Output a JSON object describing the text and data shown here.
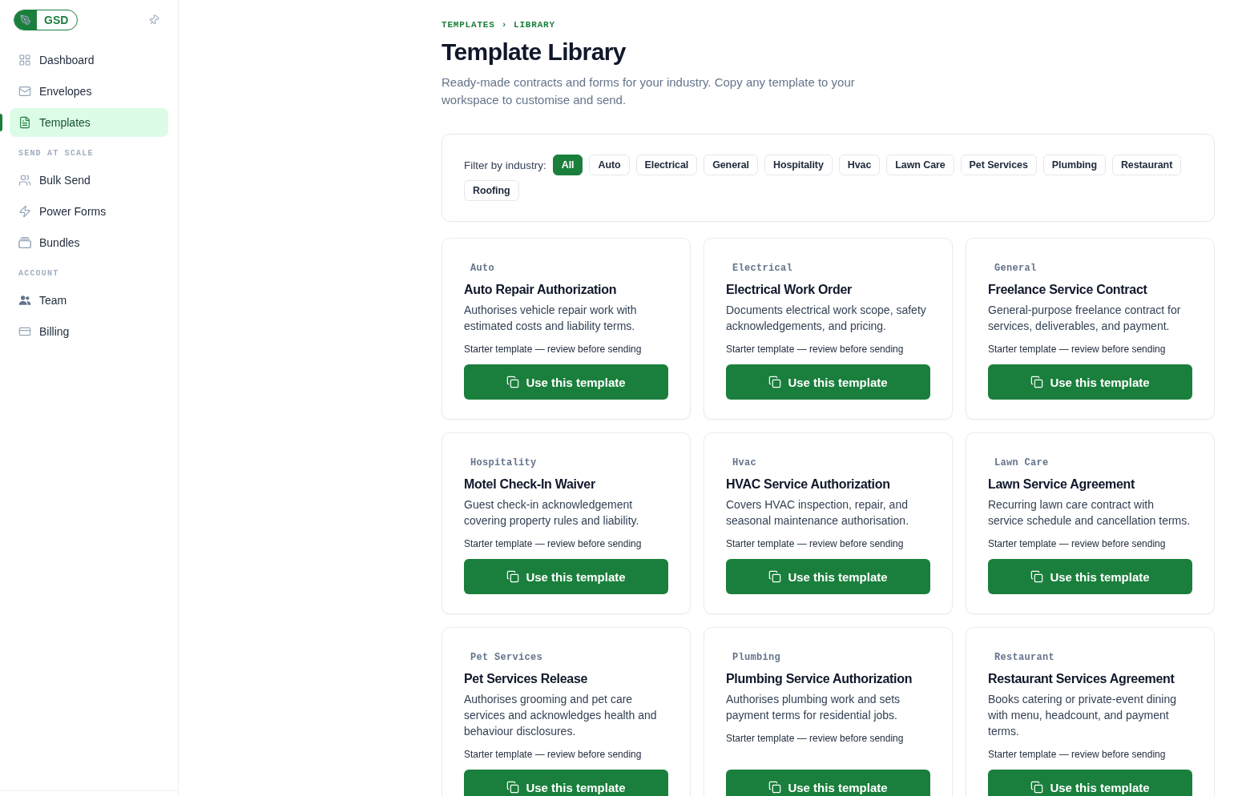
{
  "sidebar": {
    "logo": {
      "text": "GSD"
    },
    "sections": [
      {
        "items": [
          {
            "label": "Dashboard",
            "selected": false
          },
          {
            "label": "Envelopes",
            "selected": false
          },
          {
            "label": "Templates",
            "selected": true
          }
        ]
      },
      {
        "heading": "SEND AT SCALE",
        "items": [
          {
            "label": "Bulk Send",
            "selected": false
          },
          {
            "label": "Power Forms",
            "selected": false
          },
          {
            "label": "Bundles",
            "selected": false
          }
        ]
      },
      {
        "heading": "ACCOUNT",
        "items": [
          {
            "label": "Team",
            "selected": false
          },
          {
            "label": "Billing",
            "selected": false
          }
        ]
      }
    ]
  },
  "breadcrumb": {
    "items": [
      "TEMPLATES",
      "LIBRARY"
    ],
    "separator": "›"
  },
  "title": "Template Library",
  "subtitle": "Ready-made contracts and forms for your industry. Copy any template to your workspace to customise and send.",
  "filter": {
    "label": "Filter by industry:",
    "chips": [
      {
        "label": "All",
        "selected": true
      },
      {
        "label": "Auto",
        "selected": false
      },
      {
        "label": "Electrical",
        "selected": false
      },
      {
        "label": "General",
        "selected": false
      },
      {
        "label": "Hospitality",
        "selected": false
      },
      {
        "label": "Hvac",
        "selected": false
      },
      {
        "label": "Lawn Care",
        "selected": false
      },
      {
        "label": "Pet Services",
        "selected": false
      },
      {
        "label": "Plumbing",
        "selected": false
      },
      {
        "label": "Restaurant",
        "selected": false
      },
      {
        "label": "Roofing",
        "selected": false
      }
    ]
  },
  "templates": [
    {
      "category": "Auto",
      "title": "Auto Repair Authorization",
      "description": "Authorises vehicle repair work with estimated costs and liability terms.",
      "note": "Starter template — review before sending",
      "button": "Use this template"
    },
    {
      "category": "Electrical",
      "title": "Electrical Work Order",
      "description": "Documents electrical work scope, safety acknowledgements, and pricing.",
      "note": "Starter template — review before sending",
      "button": "Use this template"
    },
    {
      "category": "General",
      "title": "Freelance Service Contract",
      "description": "General-purpose freelance contract for services, deliverables, and payment.",
      "note": "Starter template — review before sending",
      "button": "Use this template"
    },
    {
      "category": "Hospitality",
      "title": "Motel Check-In Waiver",
      "description": "Guest check-in acknowledgement covering property rules and liability.",
      "note": "Starter template — review before sending",
      "button": "Use this template"
    },
    {
      "category": "Hvac",
      "title": "HVAC Service Authorization",
      "description": "Covers HVAC inspection, repair, and seasonal maintenance authorisation.",
      "note": "Starter template — review before sending",
      "button": "Use this template"
    },
    {
      "category": "Lawn Care",
      "title": "Lawn Service Agreement",
      "description": "Recurring lawn care contract with service schedule and cancellation terms.",
      "note": "Starter template — review before sending",
      "button": "Use this template"
    },
    {
      "category": "Pet Services",
      "title": "Pet Services Release",
      "description": "Authorises grooming and pet care services and acknowledges health and behaviour disclosures.",
      "note": "Starter template — review before sending",
      "button": "Use this template"
    },
    {
      "category": "Plumbing",
      "title": "Plumbing Service Authorization",
      "description": "Authorises plumbing work and sets payment terms for residential jobs.",
      "note": "Starter template — review before sending",
      "button": "Use this template"
    },
    {
      "category": "Restaurant",
      "title": "Restaurant Services Agreement",
      "description": "Books catering or private-event dining with menu, headcount, and payment terms.",
      "note": "Starter template — review before sending",
      "button": "Use this template"
    }
  ]
}
